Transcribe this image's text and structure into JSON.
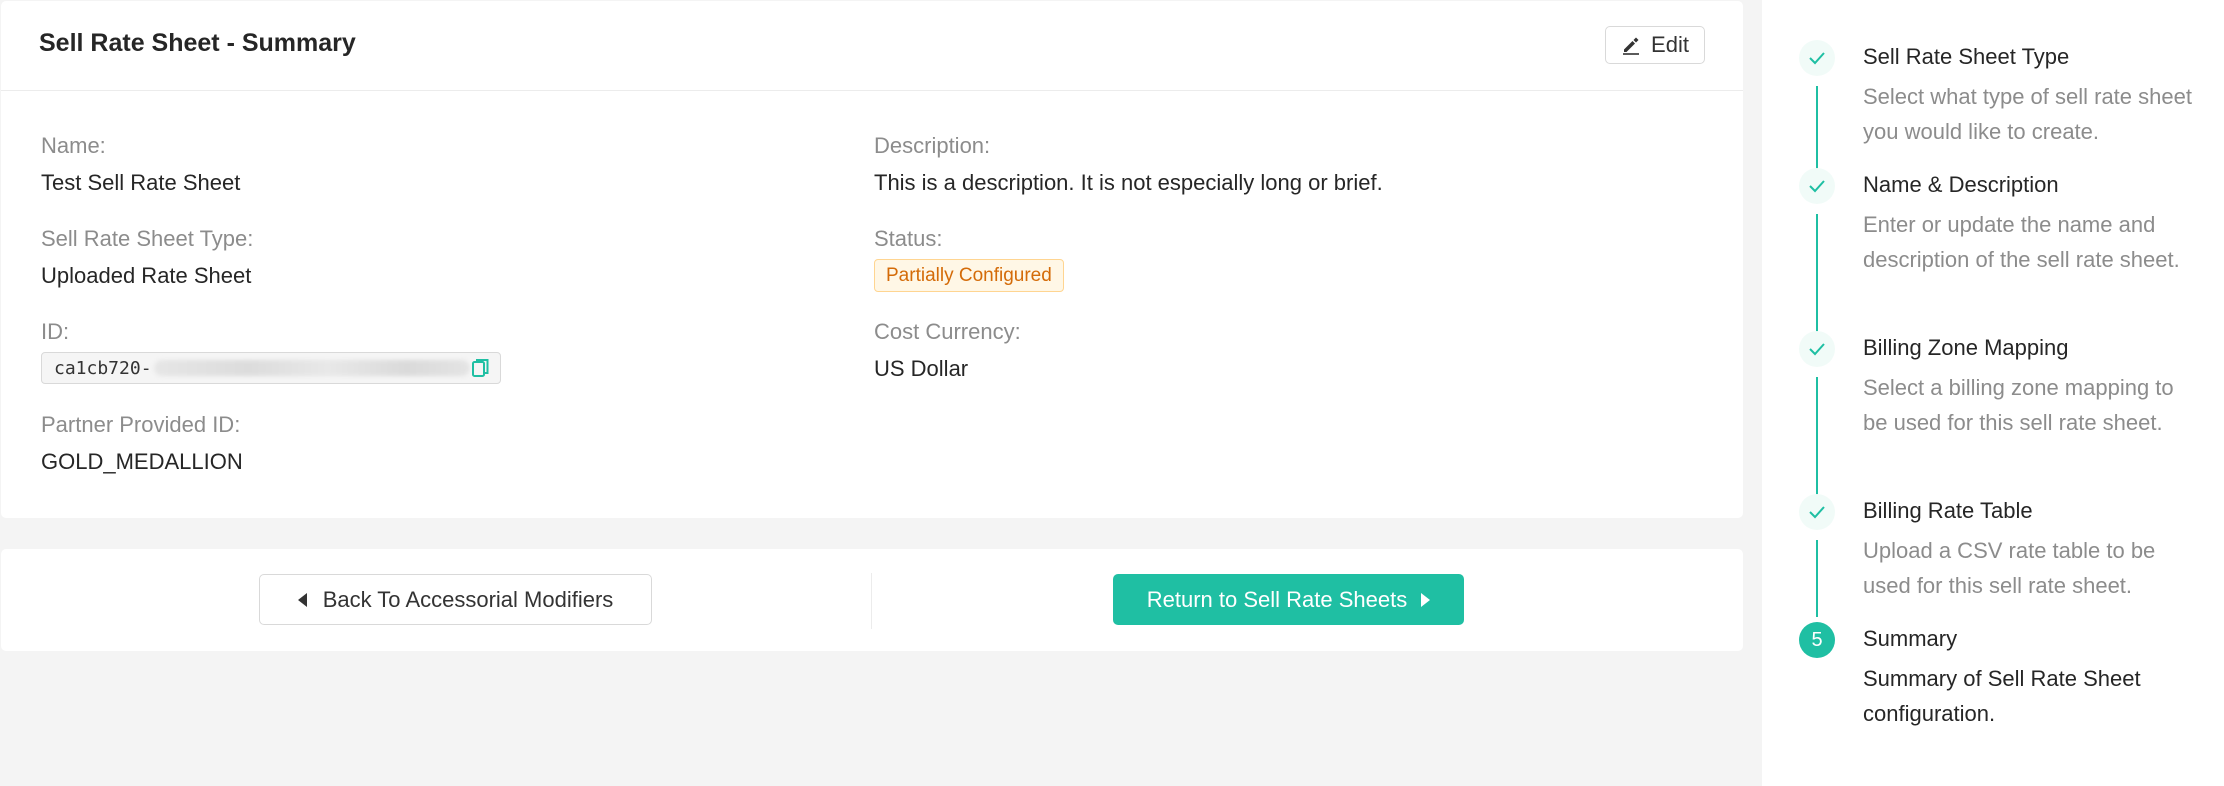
{
  "summary": {
    "title": "Sell Rate Sheet - Summary",
    "edit_label": "Edit",
    "fields": {
      "name_label": "Name:",
      "name_value": "Test Sell Rate Sheet",
      "type_label": "Sell Rate Sheet Type:",
      "type_value": "Uploaded Rate Sheet",
      "id_label": "ID:",
      "id_value": "ca1cb720-",
      "partner_id_label": "Partner Provided ID:",
      "partner_id_value": "GOLD_MEDALLION",
      "description_label": "Description:",
      "description_value": "This is a description. It is not especially long or brief.",
      "status_label": "Status:",
      "status_value": "Partially Configured",
      "currency_label": "Cost Currency:",
      "currency_value": "US Dollar"
    }
  },
  "footer": {
    "back_label": "Back To Accessorial Modifiers",
    "return_label": "Return to Sell Rate Sheets"
  },
  "steps": [
    {
      "title": "Sell Rate Sheet Type",
      "description": "Select what type of sell rate sheet you would like to create.",
      "state": "done",
      "icon": "check-icon"
    },
    {
      "title": "Name & Description",
      "description": "Enter or update the name and description of the sell rate sheet.",
      "state": "done",
      "icon": "check-icon"
    },
    {
      "title": "Billing Zone Mapping",
      "description": "Select a billing zone mapping to be used for this sell rate sheet.",
      "state": "done",
      "icon": "check-icon"
    },
    {
      "title": "Billing Rate Table",
      "description": "Upload a CSV rate table to be used for this sell rate sheet.",
      "state": "done",
      "icon": "check-icon"
    },
    {
      "title": "Summary",
      "description": "Summary of Sell Rate Sheet configuration.",
      "state": "active",
      "number": "5"
    }
  ],
  "colors": {
    "accent": "#1fbfa3",
    "status_text": "#d46b08",
    "status_bg": "#fff7e6"
  }
}
